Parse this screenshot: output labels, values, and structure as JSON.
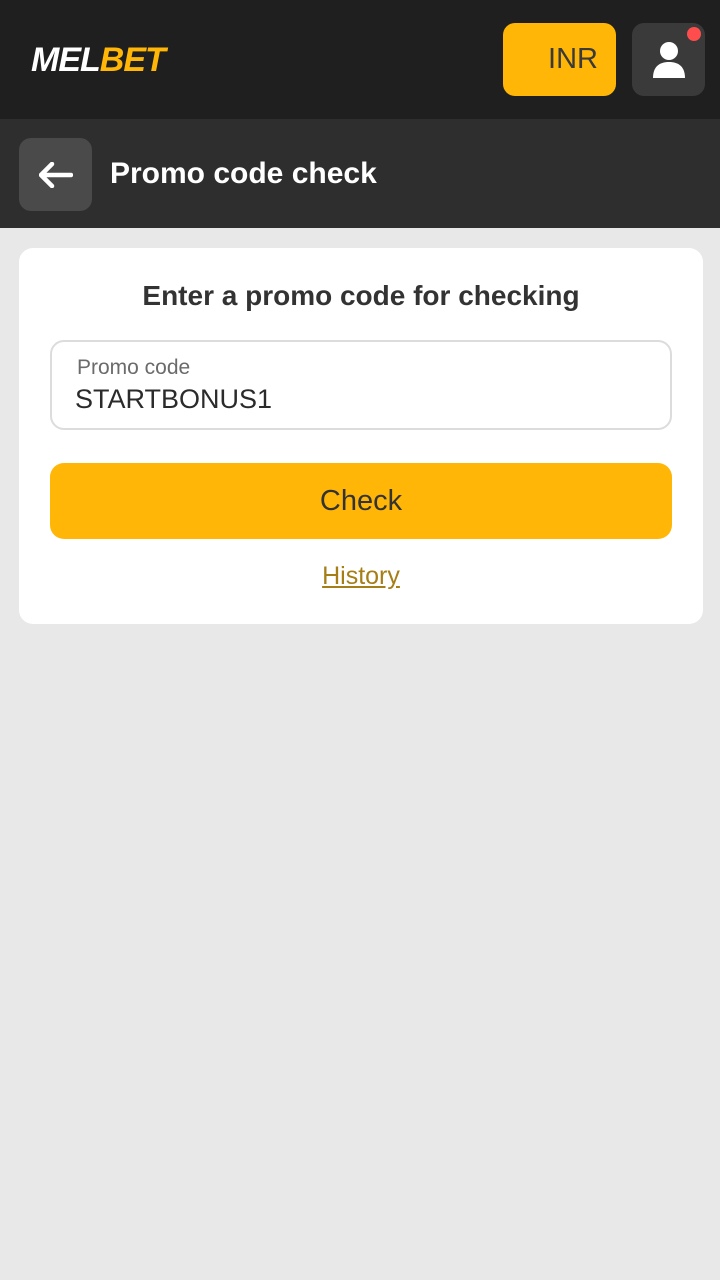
{
  "header": {
    "logo_part1": "MEL",
    "logo_part2": "BET",
    "currency": "INR"
  },
  "subheader": {
    "title": "Promo code check"
  },
  "card": {
    "title": "Enter a promo code for checking",
    "field_label": "Promo code",
    "field_value": "STARTBONUS1",
    "check_label": "Check",
    "history_label": "History"
  },
  "colors": {
    "accent": "#ffb606",
    "topbar": "#1f1f1f",
    "subheader": "#2e2e2e",
    "background": "#e8e8e8",
    "notification": "#ff4d4d",
    "link": "#a57e15"
  },
  "icons": {
    "back": "arrow-left-icon",
    "profile": "user-icon"
  }
}
